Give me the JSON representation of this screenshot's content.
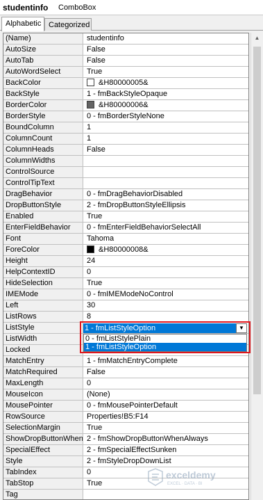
{
  "window": {
    "object_name": "studentinfo",
    "object_type": "ComboBox"
  },
  "tabs": [
    {
      "label": "Alphabetic",
      "active": true
    },
    {
      "label": "Categorized",
      "active": false
    }
  ],
  "properties": [
    {
      "name": "(Name)",
      "value": "studentinfo"
    },
    {
      "name": "AutoSize",
      "value": "False"
    },
    {
      "name": "AutoTab",
      "value": "False"
    },
    {
      "name": "AutoWordSelect",
      "value": "True"
    },
    {
      "name": "BackColor",
      "value": "&H80000005&",
      "swatch": "#ffffff"
    },
    {
      "name": "BackStyle",
      "value": "1 - fmBackStyleOpaque"
    },
    {
      "name": "BorderColor",
      "value": "&H80000006&",
      "swatch": "#646464"
    },
    {
      "name": "BorderStyle",
      "value": "0 - fmBorderStyleNone"
    },
    {
      "name": "BoundColumn",
      "value": "1"
    },
    {
      "name": "ColumnCount",
      "value": "1"
    },
    {
      "name": "ColumnHeads",
      "value": "False"
    },
    {
      "name": "ColumnWidths",
      "value": ""
    },
    {
      "name": "ControlSource",
      "value": ""
    },
    {
      "name": "ControlTipText",
      "value": ""
    },
    {
      "name": "DragBehavior",
      "value": "0 - fmDragBehaviorDisabled"
    },
    {
      "name": "DropButtonStyle",
      "value": "2 - fmDropButtonStyleEllipsis"
    },
    {
      "name": "Enabled",
      "value": "True"
    },
    {
      "name": "EnterFieldBehavior",
      "value": "0 - fmEnterFieldBehaviorSelectAll"
    },
    {
      "name": "Font",
      "value": "Tahoma"
    },
    {
      "name": "ForeColor",
      "value": "&H80000008&",
      "swatch": "#000000"
    },
    {
      "name": "Height",
      "value": "24"
    },
    {
      "name": "HelpContextID",
      "value": "0"
    },
    {
      "name": "HideSelection",
      "value": "True"
    },
    {
      "name": "IMEMode",
      "value": "0 - fmIMEModeNoControl"
    },
    {
      "name": "Left",
      "value": "30"
    },
    {
      "name": "ListRows",
      "value": "8"
    },
    {
      "name": "ListStyle",
      "value": ""
    },
    {
      "name": "ListWidth",
      "value": ""
    },
    {
      "name": "Locked",
      "value": ""
    },
    {
      "name": "MatchEntry",
      "value": "1 - fmMatchEntryComplete"
    },
    {
      "name": "MatchRequired",
      "value": "False"
    },
    {
      "name": "MaxLength",
      "value": "0"
    },
    {
      "name": "MouseIcon",
      "value": "(None)"
    },
    {
      "name": "MousePointer",
      "value": "0 - fmMousePointerDefault"
    },
    {
      "name": "RowSource",
      "value": "Properties!B5:F14"
    },
    {
      "name": "SelectionMargin",
      "value": "True"
    },
    {
      "name": "ShowDropButtonWhen",
      "value": "2 - fmShowDropButtonWhenAlways"
    },
    {
      "name": "SpecialEffect",
      "value": "2 - fmSpecialEffectSunken"
    },
    {
      "name": "Style",
      "value": "2 - fmStyleDropDownList"
    },
    {
      "name": "TabIndex",
      "value": "0"
    },
    {
      "name": "TabStop",
      "value": "True"
    },
    {
      "name": "Tag",
      "value": ""
    }
  ],
  "dropdown": {
    "current_value": "1 - fmListStyleOption",
    "options": [
      {
        "label": "0 - fmListStylePlain",
        "selected": false
      },
      {
        "label": "1 - fmListStyleOption",
        "selected": true
      }
    ],
    "highlight_color": "#e0161c",
    "selection_color": "#0078d7"
  },
  "watermark": {
    "brand": "exceldemy",
    "tagline": "EXCEL · DATA · BI"
  }
}
